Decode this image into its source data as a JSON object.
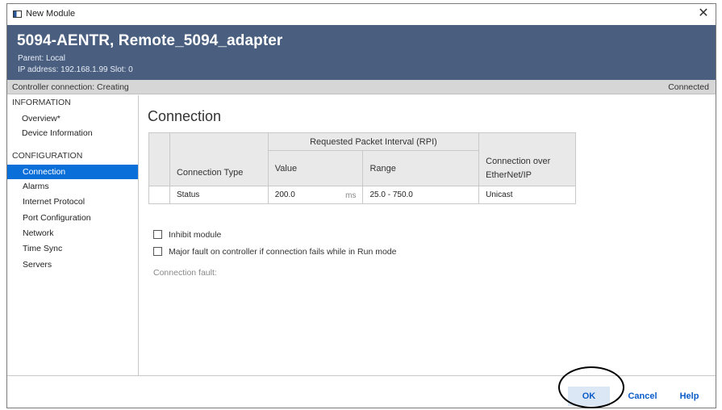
{
  "window": {
    "title": "New Module",
    "close_glyph": "✕"
  },
  "header": {
    "module_name": "5094-AENTR, Remote_5094_adapter",
    "parent": "Parent: Local",
    "ip_slot": "IP address: 192.168.1.99  Slot: 0"
  },
  "status": {
    "connection": "Controller connection: Creating",
    "state": "Connected"
  },
  "sidebar": {
    "information_title": "INFORMATION",
    "information_items": [
      "Overview*",
      "Device Information"
    ],
    "configuration_title": "CONFIGURATION",
    "configuration_items": [
      "Connection",
      "Alarms",
      "Internet Protocol",
      "Port Configuration",
      "Network",
      "Time Sync",
      "Servers"
    ],
    "selected": "Connection"
  },
  "content": {
    "heading": "Connection",
    "table": {
      "rpi_header": "Requested Packet Interval (RPI)",
      "columns": [
        "Connection Type",
        "Value",
        "Range",
        "Connection over EtherNet/IP"
      ],
      "rows": [
        {
          "type": "Status",
          "value": "200.0",
          "unit": "ms",
          "range": "25.0 - 750.0",
          "connection_over": "Unicast"
        }
      ]
    },
    "inhibit_label": "Inhibit module",
    "major_fault_label": "Major fault on controller if connection fails while in Run mode",
    "fault_label": "Connection fault:"
  },
  "footer": {
    "ok": "OK",
    "cancel": "Cancel",
    "help": "Help"
  }
}
